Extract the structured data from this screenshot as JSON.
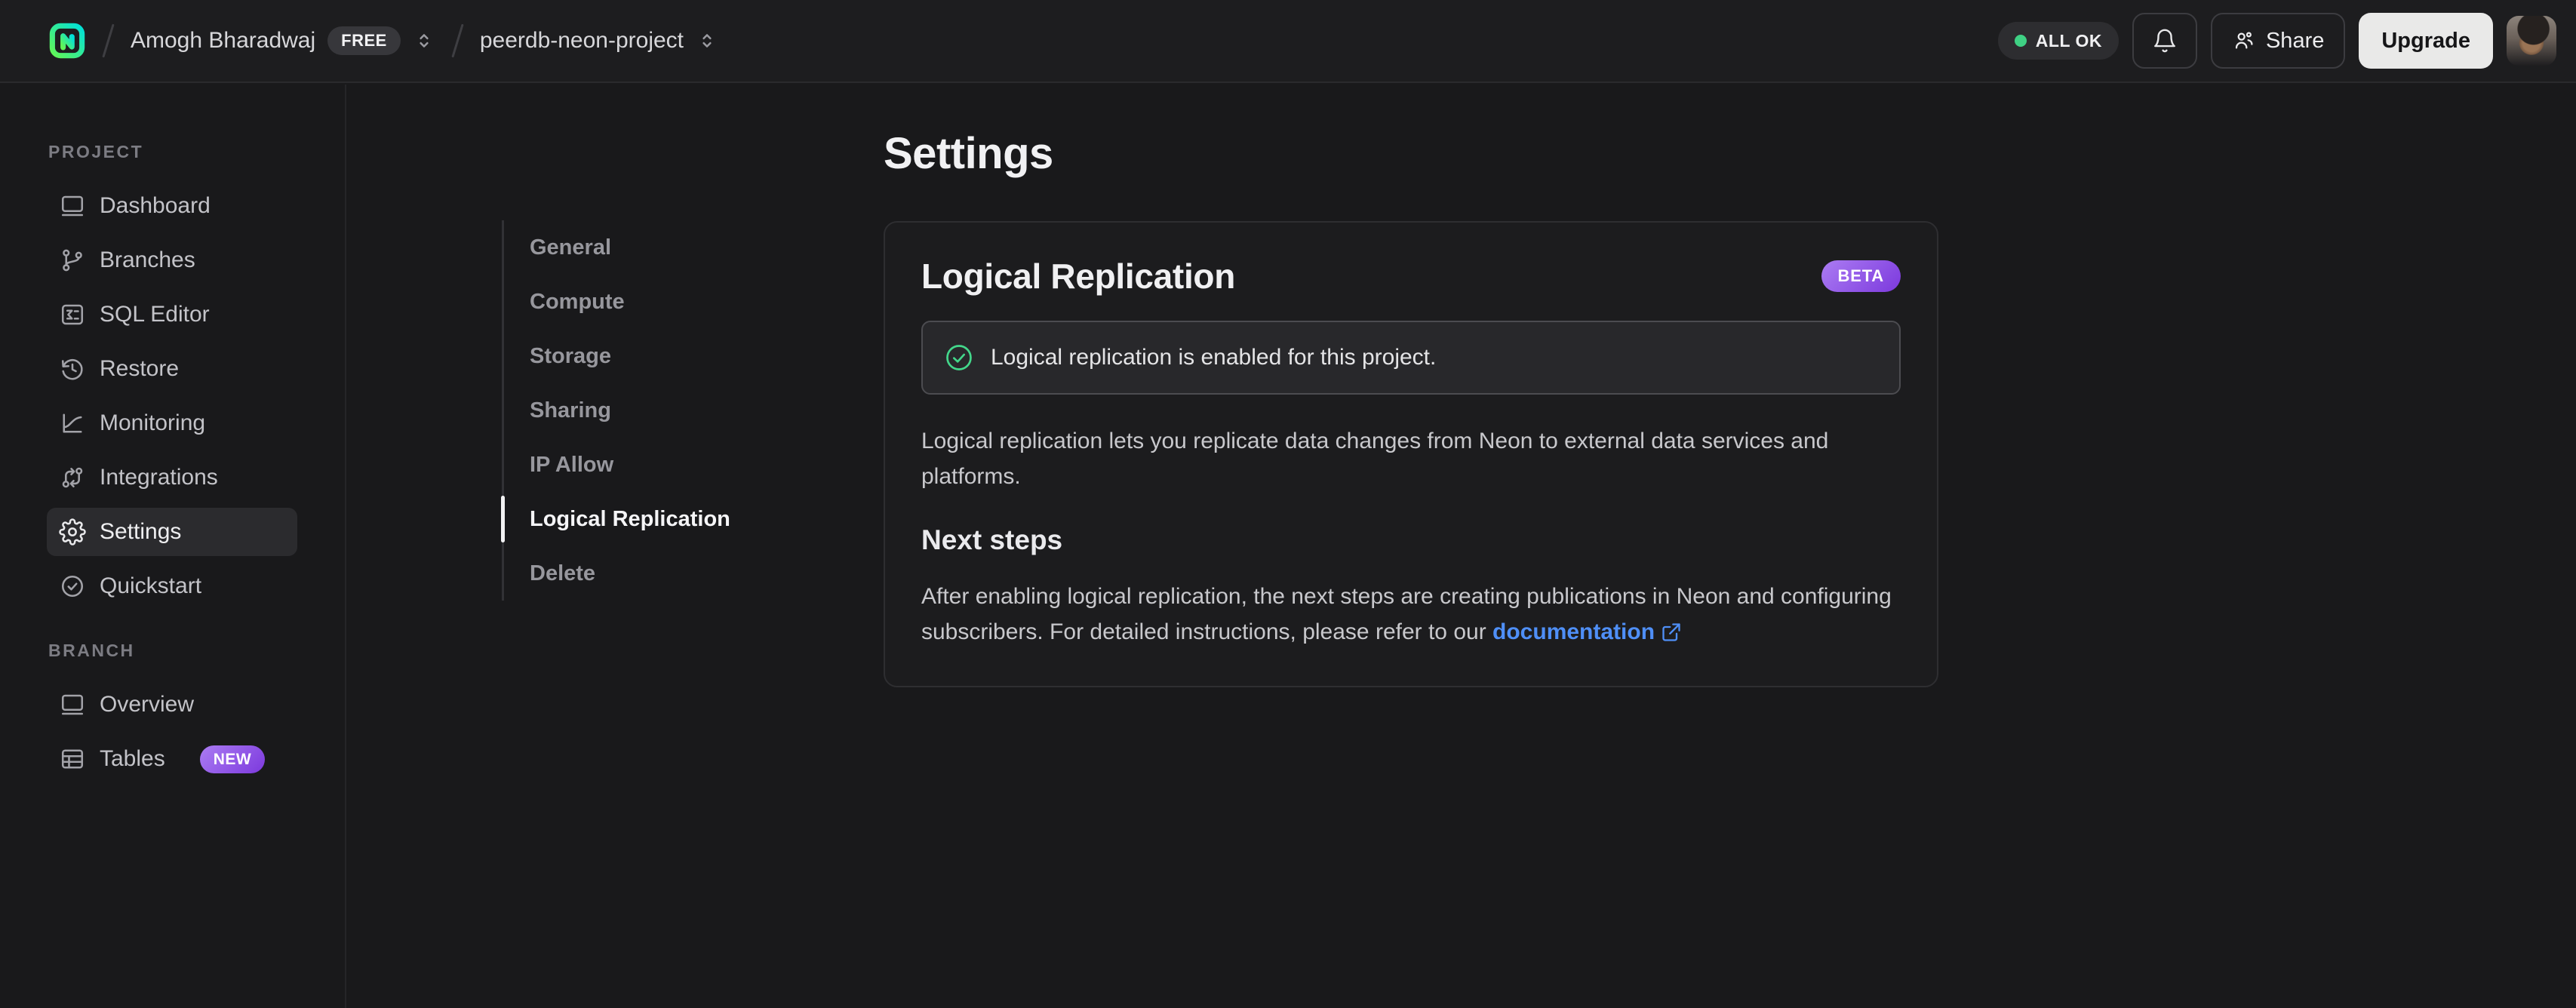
{
  "topbar": {
    "org_name": "Amogh Bharadwaj",
    "org_plan_badge": "FREE",
    "project_name": "peerdb-neon-project",
    "status_label": "ALL OK",
    "share_label": "Share",
    "upgrade_label": "Upgrade"
  },
  "sidebar": {
    "sections": [
      {
        "label": "PROJECT",
        "items": [
          {
            "label": "Dashboard"
          },
          {
            "label": "Branches"
          },
          {
            "label": "SQL Editor"
          },
          {
            "label": "Restore"
          },
          {
            "label": "Monitoring"
          },
          {
            "label": "Integrations"
          },
          {
            "label": "Settings",
            "active": true
          },
          {
            "label": "Quickstart"
          }
        ]
      },
      {
        "label": "BRANCH",
        "items": [
          {
            "label": "Overview"
          },
          {
            "label": "Tables",
            "badge": "NEW"
          }
        ]
      }
    ]
  },
  "settings_nav": {
    "items": [
      {
        "label": "General"
      },
      {
        "label": "Compute"
      },
      {
        "label": "Storage"
      },
      {
        "label": "Sharing"
      },
      {
        "label": "IP Allow"
      },
      {
        "label": "Logical Replication",
        "active": true
      },
      {
        "label": "Delete"
      }
    ]
  },
  "main": {
    "page_title": "Settings",
    "card": {
      "title": "Logical Replication",
      "beta_badge": "BETA",
      "alert_text": "Logical replication is enabled for this project.",
      "description": "Logical replication lets you replicate data changes from Neon to external data services and platforms.",
      "next_steps_title": "Next steps",
      "next_steps_text": "After enabling logical replication, the next steps are creating publications in Neon and configuring subscribers. For detailed instructions, please refer to our ",
      "doc_link_label": "documentation"
    }
  },
  "colors": {
    "accent_green": "#3fd184",
    "badge_purple_from": "#ab7cf3",
    "badge_purple_to": "#7c39dd",
    "link_blue": "#4f8ff7"
  }
}
